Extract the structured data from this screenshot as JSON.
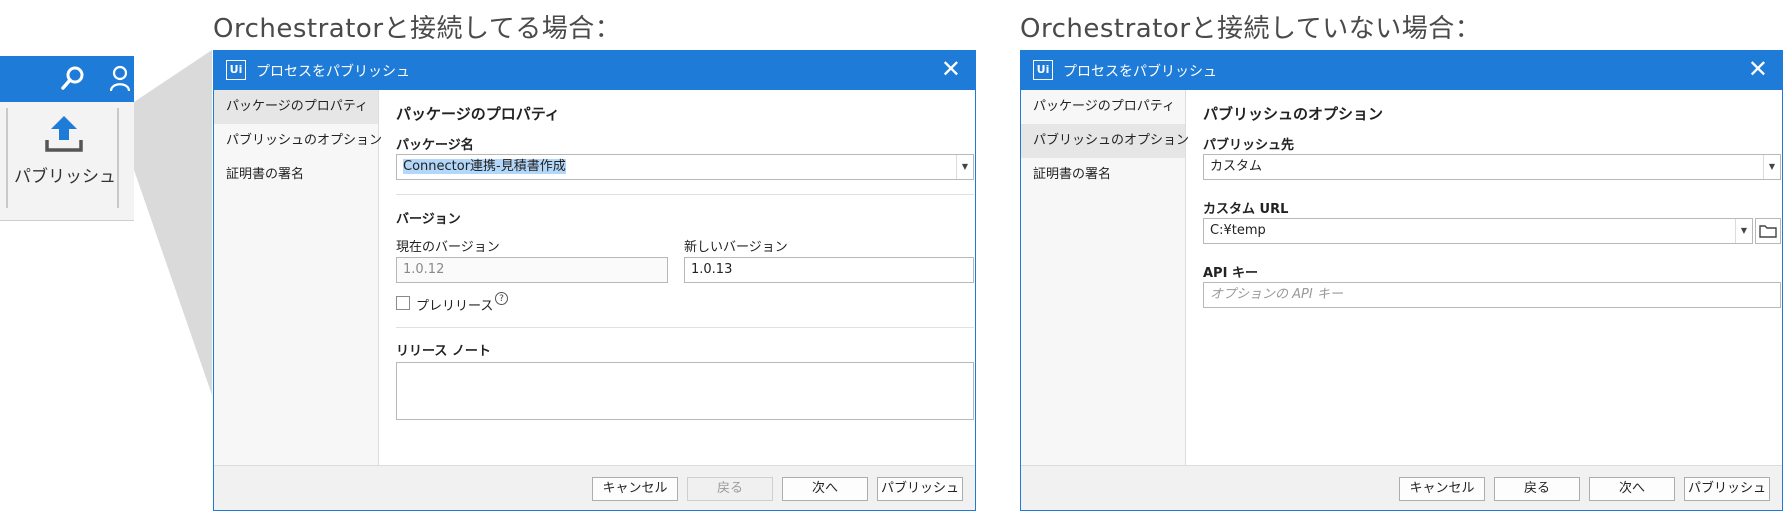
{
  "captions": {
    "left": "Orchestratorと接続してる場合：",
    "right": "Orchestratorと接続していない場合："
  },
  "ribbon": {
    "publish_label": "パブリッシュ",
    "icons": [
      "search-icon",
      "person-icon",
      "upload-icon"
    ],
    "accent": "#1e7bd7"
  },
  "dialog_connected": {
    "title": "プロセスをパブリッシュ",
    "sidebar": [
      "パッケージのプロパティ",
      "パブリッシュのオプション",
      "証明書の署名"
    ],
    "active_index": 0,
    "section_title": "パッケージのプロパティ",
    "package_name_label": "パッケージ名",
    "package_name_value": "Connector連携-見積書作成",
    "version_label": "バージョン",
    "current_version_label": "現在のバージョン",
    "current_version_value": "1.0.12",
    "new_version_label": "新しいバージョン",
    "new_version_value": "1.0.13",
    "prerelease_label": "プレリリース",
    "prerelease_checked": false,
    "release_notes_label": "リリース ノート",
    "release_notes_value": "",
    "buttons": {
      "cancel": "キャンセル",
      "back": "戻る",
      "next": "次へ",
      "publish": "パブリッシュ"
    }
  },
  "dialog_disconnected": {
    "title": "プロセスをパブリッシュ",
    "sidebar": [
      "パッケージのプロパティ",
      "パブリッシュのオプション",
      "証明書の署名"
    ],
    "active_index": 1,
    "section_title": "パブリッシュのオプション",
    "publish_to_label": "パブリッシュ先",
    "publish_to_value": "カスタム",
    "custom_url_label": "カスタム URL",
    "custom_url_value": "C:¥temp",
    "api_key_label": "API キー",
    "api_key_placeholder": "オプションの API キー",
    "buttons": {
      "cancel": "キャンセル",
      "back": "戻る",
      "next": "次へ",
      "publish": "パブリッシュ"
    }
  }
}
